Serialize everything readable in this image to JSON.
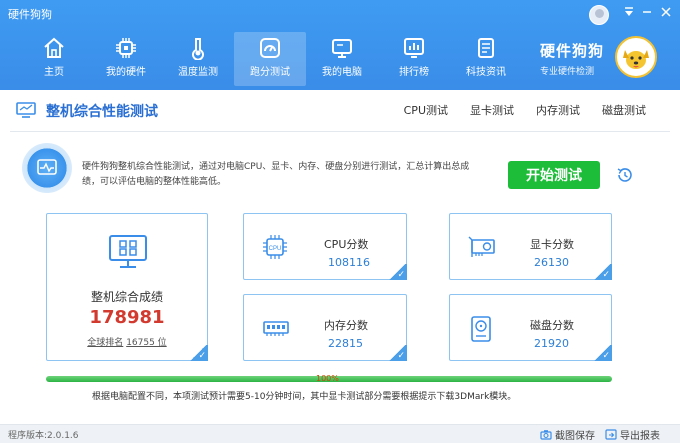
{
  "app": {
    "title": "硬件狗狗"
  },
  "brand": {
    "name": "硬件狗狗",
    "tagline": "专业硬件检测",
    "logo": "dog-logo"
  },
  "nav": [
    {
      "label": "主页",
      "icon": "home-icon"
    },
    {
      "label": "我的硬件",
      "icon": "chip-icon"
    },
    {
      "label": "温度监测",
      "icon": "thermometer-icon"
    },
    {
      "label": "跑分测试",
      "icon": "gauge-icon",
      "active": true
    },
    {
      "label": "我的电脑",
      "icon": "monitor-icon"
    },
    {
      "label": "排行榜",
      "icon": "ranking-icon"
    },
    {
      "label": "科技资讯",
      "icon": "news-icon"
    }
  ],
  "subhead": {
    "title": "整机综合性能测试",
    "tabs": [
      "CPU测试",
      "显卡测试",
      "内存测试",
      "磁盘测试"
    ]
  },
  "intro": {
    "text": "硬件狗狗整机综合性能测试，通过对电脑CPU、显卡、内存、硬盘分别进行测试，汇总计算出总成绩，可以评估电脑的整体性能高低。",
    "start_button": "开始测试"
  },
  "total": {
    "label": "整机综合成绩",
    "score": "178981",
    "rank_prefix": "全球排名",
    "rank_value": "16755 位"
  },
  "scores": {
    "cpu": {
      "label": "CPU分数",
      "value": "108116"
    },
    "gpu": {
      "label": "显卡分数",
      "value": "26130"
    },
    "memory": {
      "label": "内存分数",
      "value": "22815"
    },
    "disk": {
      "label": "磁盘分数",
      "value": "21920"
    }
  },
  "progress": {
    "percent_text": "100%",
    "value": 1.0
  },
  "note": "根据电脑配置不同，本项测试预计需要5-10分钟时间，其中显卡测试部分需要根据提示下载3DMark模块。",
  "status": {
    "version": "程序版本:2.0.1.6",
    "save_image": "截图保存",
    "export_report": "导出报表"
  },
  "colors": {
    "header": "#3a8de8",
    "accent": "#2a6fd3",
    "start_button": "#1ebd39",
    "total_score": "#d23a2f"
  }
}
